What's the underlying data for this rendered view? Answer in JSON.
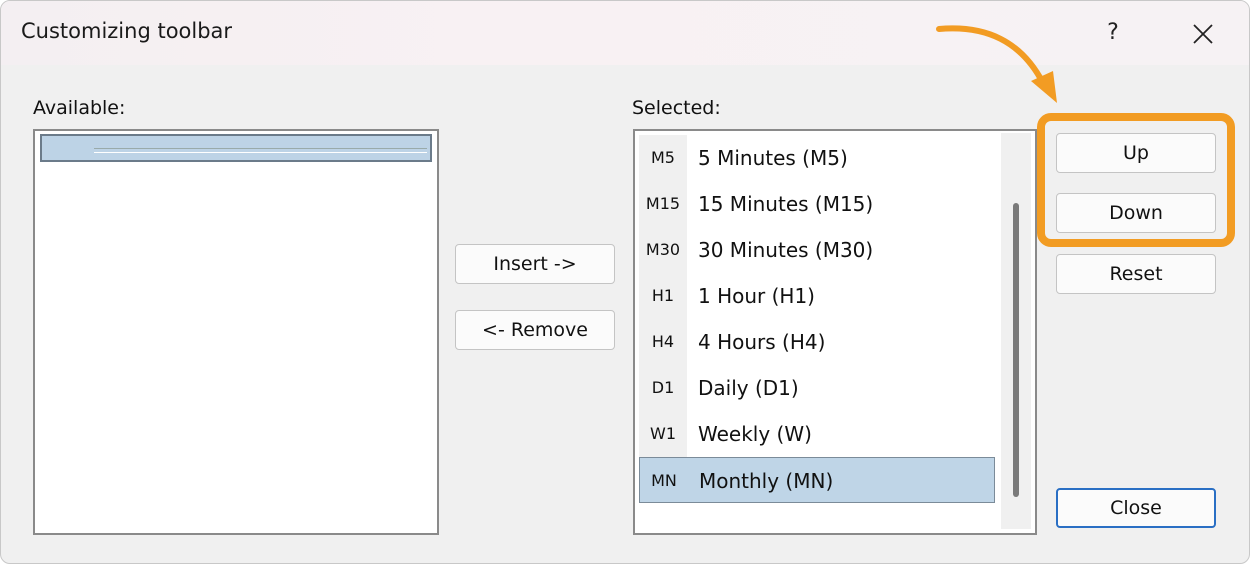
{
  "window": {
    "title": "Customizing toolbar",
    "help_label": "?"
  },
  "available": {
    "label": "Available:"
  },
  "selected": {
    "label": "Selected:",
    "items": [
      {
        "icon": "M5",
        "label": "5 Minutes (M5)"
      },
      {
        "icon": "M15",
        "label": "15 Minutes (M15)"
      },
      {
        "icon": "M30",
        "label": "30 Minutes (M30)"
      },
      {
        "icon": "H1",
        "label": "1 Hour (H1)"
      },
      {
        "icon": "H4",
        "label": "4 Hours (H4)"
      },
      {
        "icon": "D1",
        "label": "Daily (D1)"
      },
      {
        "icon": "W1",
        "label": "Weekly (W)"
      },
      {
        "icon": "MN",
        "label": "Monthly (MN)",
        "selected": true
      }
    ]
  },
  "buttons": {
    "insert": "Insert ->",
    "remove": "<- Remove",
    "up": "Up",
    "down": "Down",
    "reset": "Reset",
    "close": "Close"
  },
  "colors": {
    "highlight": "#f29c23",
    "selection": "#bfd5e7",
    "primary_border": "#2a6fc4"
  }
}
